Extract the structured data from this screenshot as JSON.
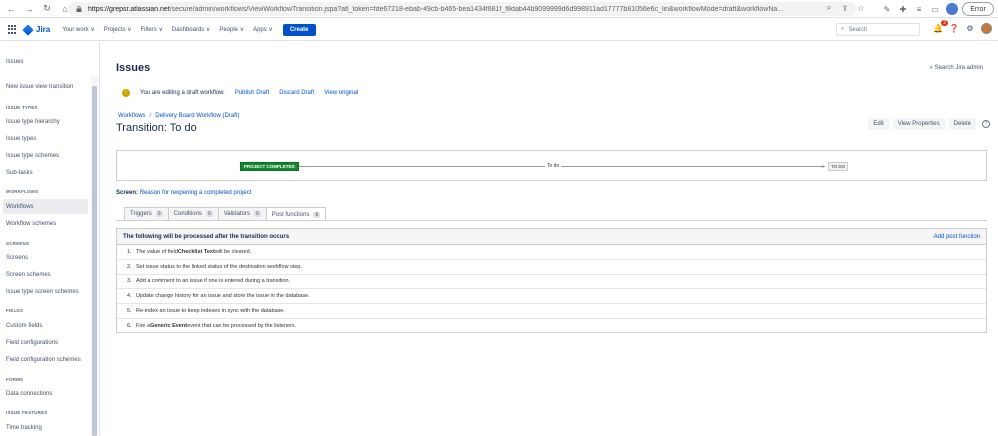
{
  "browser": {
    "url_host": "https://grepsr.atlassian.net",
    "url_path": "/secure/admin/workflows/ViewWorkflowTransition.jspa?atl_token=fde67218-ebab-49cb-b465-bea1434f681f_f8dab44b9099999d6d998911ad17777b81056e6c_lin&workflowMode=draft&workflowNa...",
    "error_label": "Error"
  },
  "topnav": {
    "product": "Jira",
    "menu": [
      "Your work ∨",
      "Projects ∨",
      "Filters ∨",
      "Dashboards ∨",
      "People ∨",
      "Apps ∨"
    ],
    "create_label": "Create",
    "search_placeholder": "Search",
    "notification_count": "2"
  },
  "sidebar": {
    "items": [
      {
        "label": "Issues",
        "type": "item"
      },
      {
        "label": "New issue view transition",
        "type": "item"
      },
      {
        "label": "ISSUE TYPES",
        "type": "head"
      },
      {
        "label": "Issue type hierarchy",
        "type": "item"
      },
      {
        "label": "Issue types",
        "type": "item"
      },
      {
        "label": "Issue type schemes",
        "type": "item"
      },
      {
        "label": "Sub-tasks",
        "type": "item"
      },
      {
        "label": "WORKFLOWS",
        "type": "head"
      },
      {
        "label": "Workflows",
        "type": "item",
        "active": true
      },
      {
        "label": "Workflow schemes",
        "type": "item"
      },
      {
        "label": "SCREENS",
        "type": "head"
      },
      {
        "label": "Screens",
        "type": "item"
      },
      {
        "label": "Screen schemes",
        "type": "item"
      },
      {
        "label": "Issue type screen schemes",
        "type": "item"
      },
      {
        "label": "FIELDS",
        "type": "head"
      },
      {
        "label": "Custom fields",
        "type": "item"
      },
      {
        "label": "Field configurations",
        "type": "item"
      },
      {
        "label": "Field configuration schemes",
        "type": "item"
      },
      {
        "label": "FORMS",
        "type": "head"
      },
      {
        "label": "Data connections",
        "type": "item"
      },
      {
        "label": "ISSUE FEATURES",
        "type": "head"
      },
      {
        "label": "Time tracking",
        "type": "item"
      }
    ]
  },
  "main": {
    "title": "Issues",
    "search_admin": "Search Jira admin",
    "draft_notice": "You are editing a draft workflow.",
    "publish_draft": "Publish Draft",
    "discard_draft": "Discard Draft",
    "view_original": "View original",
    "breadcrumb": {
      "root": "Workflows",
      "sep": "/",
      "current": "Delivery Board Workflow (Draft)"
    },
    "transition_title": "Transition: To do",
    "actions": {
      "edit": "Edit",
      "view_properties": "View Properties",
      "delete": "Delete"
    },
    "diagram": {
      "from_status": "PROJECT COMPLETED",
      "transition_name": "To do",
      "to_status": "TO DO"
    },
    "screen": {
      "label": "Screen:",
      "value": "Reason for reopening a completed project"
    },
    "tabs": [
      {
        "label": "Triggers",
        "count": "0"
      },
      {
        "label": "Conditions",
        "count": "0"
      },
      {
        "label": "Validators",
        "count": "0"
      },
      {
        "label": "Post functions",
        "count": "6",
        "active": true
      }
    ],
    "post_functions": {
      "heading": "The following will be processed after the transition occurs",
      "add_label": "Add post function",
      "rows": [
        {
          "num": "1.",
          "pre": "The value of field ",
          "bold": "Checklist Text",
          "post": " will be cleared."
        },
        {
          "num": "2.",
          "pre": "Set issue status to the linked status of the destination workflow step.",
          "bold": "",
          "post": ""
        },
        {
          "num": "3.",
          "pre": "Add a comment to an issue if one is entered during a transition.",
          "bold": "",
          "post": ""
        },
        {
          "num": "4.",
          "pre": "Update change history for an issue and store the issue in the database.",
          "bold": "",
          "post": ""
        },
        {
          "num": "5.",
          "pre": "Re-index an issue to keep indexes in sync with the database.",
          "bold": "",
          "post": ""
        },
        {
          "num": "6.",
          "pre": "Fire a ",
          "bold": "Generic Event",
          "post": " event that can be processed by the listeners."
        }
      ]
    }
  }
}
